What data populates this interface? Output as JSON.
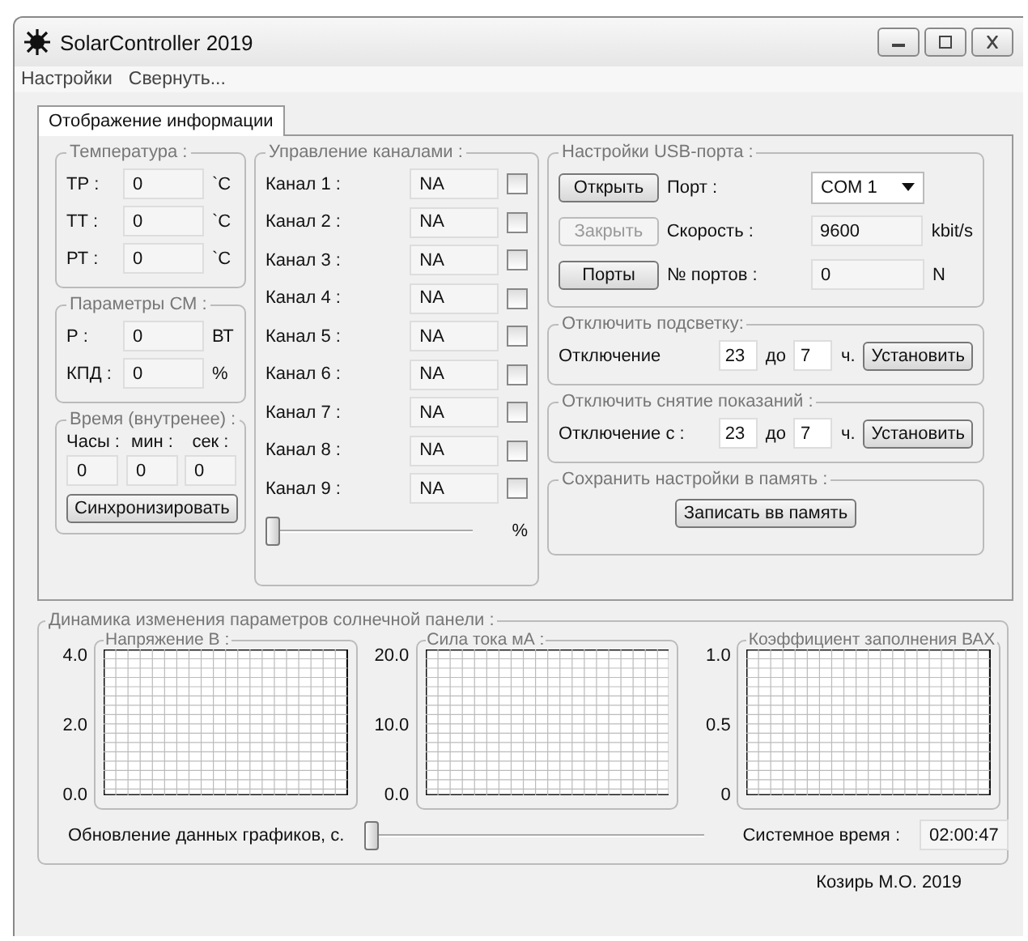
{
  "window": {
    "title": "SolarController 2019"
  },
  "menu": [
    "Настройки",
    "Свернуть..."
  ],
  "tabs": [
    {
      "label": "Отображение информации",
      "selected": true
    }
  ],
  "temperature": {
    "title": "Температура :",
    "rows": [
      {
        "label": "ТР :",
        "value": "0",
        "unit": "`C"
      },
      {
        "label": "ТТ :",
        "value": "0",
        "unit": "`C"
      },
      {
        "label": "РТ :",
        "value": "0",
        "unit": "`C"
      }
    ]
  },
  "sm_params": {
    "title": "Параметры СМ :",
    "rows": [
      {
        "label": "Р :",
        "value": "0",
        "unit": "ВТ"
      },
      {
        "label": "КПД :",
        "value": "0",
        "unit": "%"
      }
    ]
  },
  "time": {
    "title": "Время (внутренее) :",
    "labels": [
      "Часы :",
      "мин :",
      "сек :"
    ],
    "values": [
      "0",
      "0",
      "0"
    ],
    "button": "Синхронизировать"
  },
  "channels": {
    "title": "Управление каналами :",
    "items": [
      {
        "label": "Канал 1 :",
        "value": "NA",
        "checked": false
      },
      {
        "label": "Канал 2 :",
        "value": "NA",
        "checked": false
      },
      {
        "label": "Канал 3 :",
        "value": "NA",
        "checked": false
      },
      {
        "label": "Канал 4 :",
        "value": "NA",
        "checked": false
      },
      {
        "label": "Канал 5 :",
        "value": "NA",
        "checked": false
      },
      {
        "label": "Канал 6 :",
        "value": "NA",
        "checked": false
      },
      {
        "label": "Канал 7 :",
        "value": "NA",
        "checked": false
      },
      {
        "label": "Канал 8 :",
        "value": "NA",
        "checked": false
      },
      {
        "label": "Канал 9 :",
        "value": "NA",
        "checked": false
      }
    ],
    "slider": {
      "level": 0
    },
    "unit": "%"
  },
  "usb": {
    "title": "Настройки USB-порта :",
    "buttons": [
      {
        "label": "Открыть",
        "disabled": false
      },
      {
        "label": "Закрыть",
        "disabled": true
      },
      {
        "label": "Порты",
        "disabled": false
      }
    ],
    "rows": [
      {
        "kind": "dropdown",
        "label": "Порт :",
        "value": "COM 1"
      },
      {
        "kind": "field",
        "label": "Скорость :",
        "value": "9600",
        "unit": "kbit/s"
      },
      {
        "kind": "field",
        "label": "№ портов :",
        "value": "0",
        "unit": "N"
      }
    ]
  },
  "backlight": {
    "title": "Отключить подсветку:",
    "label": "Отключение",
    "from": "23",
    "to_label": "до",
    "to": "7",
    "unit": "ч.",
    "button": "Установить"
  },
  "readings": {
    "title": "Отключить снятие показаний :",
    "label": "Отключение с :",
    "from": "23",
    "to_label": "до",
    "to": "7",
    "unit": "ч.",
    "button": "Установить"
  },
  "save": {
    "title": "Сохранить настройки в память :",
    "button": "Записать вв память"
  },
  "dynamics": {
    "title": "Динамика изменения параметров солнечной панели :",
    "charts": [
      {
        "title": "Напряжение В :",
        "ticks": [
          "4.0",
          "2.0",
          "0.0"
        ]
      },
      {
        "title": "Сила тока мА :",
        "ticks": [
          "20.0",
          "10.0",
          "0.0"
        ]
      },
      {
        "title": "Коэффициент заполнения ВАХ",
        "ticks": [
          "1.0",
          "0.5",
          "0"
        ]
      }
    ],
    "update": {
      "label": "Обновление данных графиков, с.",
      "level": 0
    },
    "system_time": {
      "label": "Системное время :",
      "value": "02:00:47"
    }
  },
  "footer": "Козирь М.О. 2019"
}
